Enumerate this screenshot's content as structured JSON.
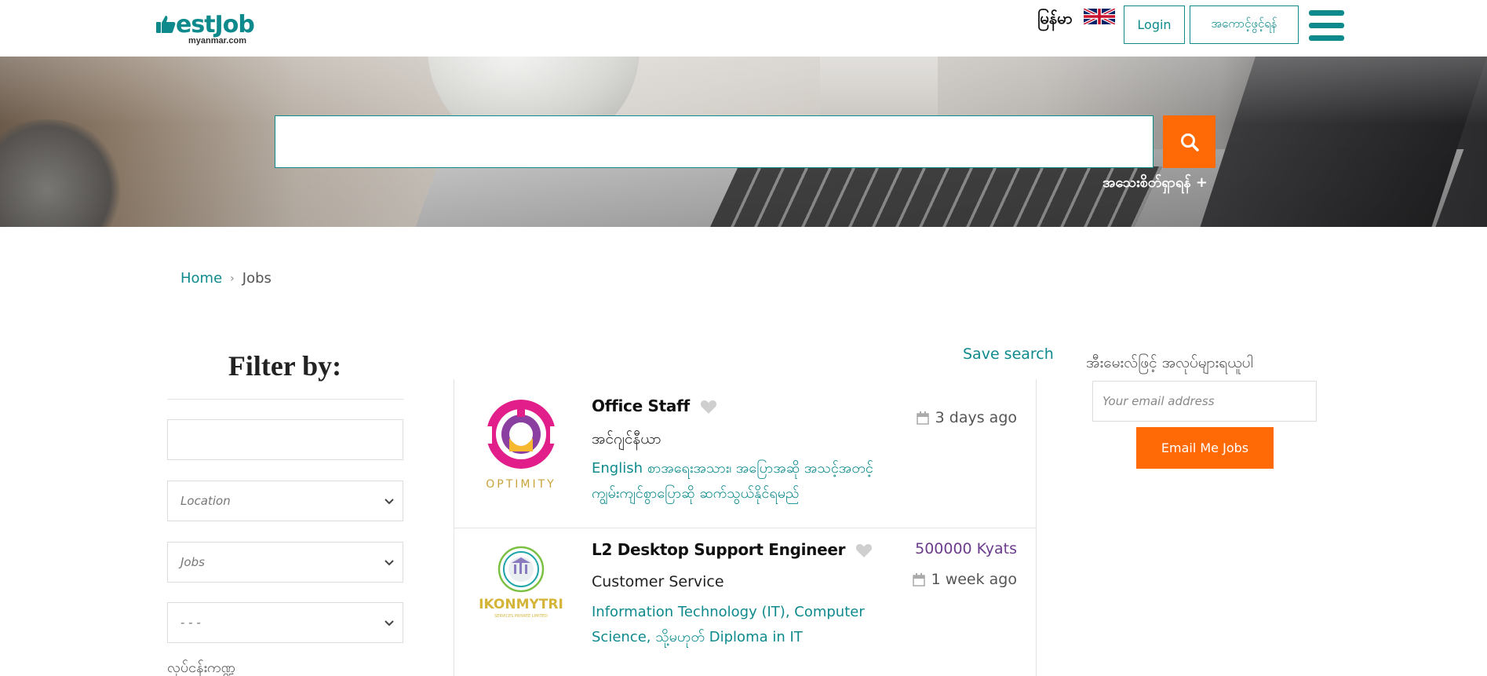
{
  "header": {
    "logo_text": "estJob",
    "logo_sub": "myanmar.com",
    "lang_mm": "မြန်မာ",
    "login_label": "Login",
    "register_label": "အကောင့်ဖွင့်ရန်"
  },
  "hero": {
    "advanced_search_label": "အသေးစိတ်ရှာရန် +"
  },
  "breadcrumb": {
    "home": "Home",
    "separator": "›",
    "current": "Jobs"
  },
  "filter": {
    "title": "Filter by:",
    "location_label": "Location",
    "jobs_label": "Jobs",
    "third_label": "- - -",
    "salary_label": "လုပ်ငန်းကဏ္ဍ"
  },
  "jobs": {
    "save_search_label": "Save search",
    "items": [
      {
        "title": "Office Staff",
        "company": "အင်ဂျင်နီယာ",
        "category": "English စာအရေးအသား၊ အပြောအဆို အသင့်အတင့်ကျွမ်းကျင်စွာပြောဆို ဆက်သွယ်နိုင်ရမည်",
        "date": "3 days ago",
        "salary": "",
        "logo_text": "OPTIMITY"
      },
      {
        "title": "L2 Desktop Support Engineer",
        "company": "Customer Service",
        "category": "Information Technology (IT), Computer Science, သို့မဟုတ် Diploma in IT",
        "date": "1 week ago",
        "salary": "500000 Kyats",
        "logo_text": "IKONMYTRI",
        "logo_sub": "SERVICES PRIVATE LIMITED"
      }
    ]
  },
  "alert": {
    "title": "အီးမေးလ်ဖြင့် အလုပ်များရယူပါ",
    "email_placeholder": "Your email address",
    "button_label": "Email Me Jobs"
  },
  "colors": {
    "brand": "#0e8a8c",
    "accent": "#ff6a07",
    "salary": "#6b3b8c"
  },
  "icons": {
    "search": "search-icon",
    "menu": "hamburger-menu-icon",
    "favorite": "heart-icon",
    "date": "calendar-icon",
    "flag": "uk-flag-icon"
  }
}
